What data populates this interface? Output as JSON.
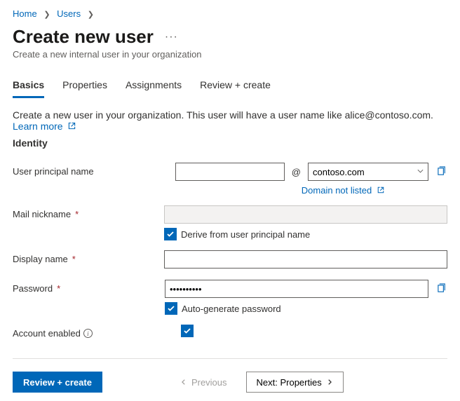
{
  "breadcrumb": {
    "home": "Home",
    "users": "Users"
  },
  "title": "Create new user",
  "subtitle": "Create a new internal user in your organization",
  "tabs": [
    "Basics",
    "Properties",
    "Assignments",
    "Review + create"
  ],
  "intro": "Create a new user in your organization. This user will have a user name like alice@contoso.com.",
  "learn_more": "Learn more",
  "section": "Identity",
  "fields": {
    "upn": {
      "label": "User principal name",
      "value": "",
      "domain": "contoso.com",
      "domain_not_listed": "Domain not listed"
    },
    "nickname": {
      "label": "Mail nickname",
      "value": "",
      "derive": "Derive from user principal name",
      "checked": true
    },
    "display": {
      "label": "Display name",
      "value": ""
    },
    "password": {
      "label": "Password",
      "value": "••••••••••",
      "auto": "Auto-generate password",
      "checked": true
    },
    "enabled": {
      "label": "Account enabled",
      "checked": true
    }
  },
  "footer": {
    "review": "Review + create",
    "prev": "Previous",
    "next": "Next: Properties"
  }
}
